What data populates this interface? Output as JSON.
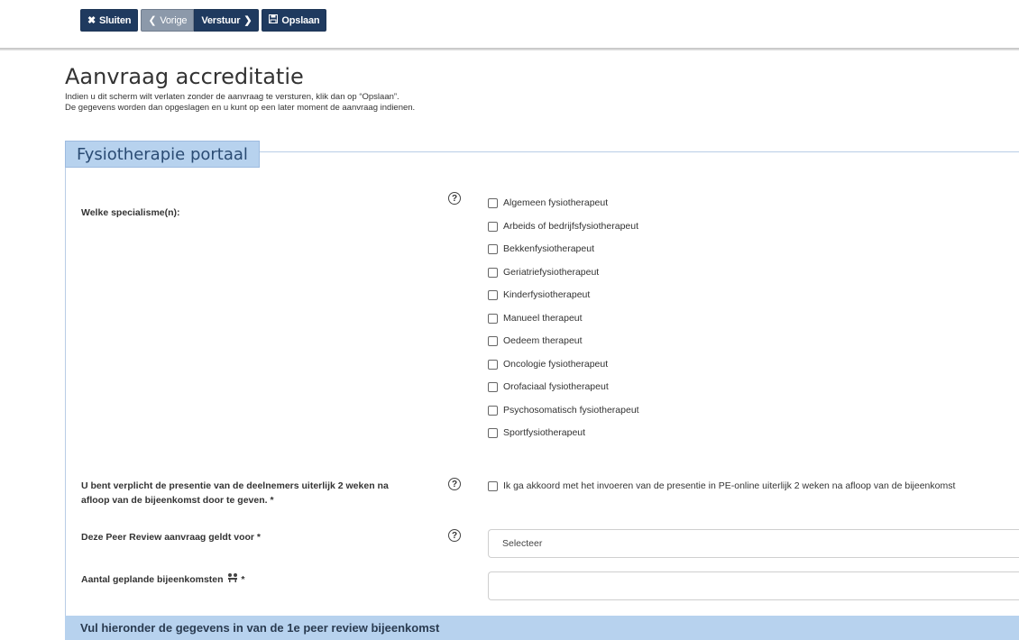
{
  "toolbar": {
    "close_label": "Sluiten",
    "prev_label": "Vorige",
    "send_label": "Verstuur",
    "save_label": "Opslaan"
  },
  "page": {
    "title": "Aanvraag accreditatie",
    "intro_line1": "Indien u dit scherm wilt verlaten zonder de aanvraag te versturen, klik dan op “Opslaan”.",
    "intro_line2": "De gegevens worden dan opgeslagen en u kunt op een later moment de aanvraag indienen."
  },
  "section": {
    "title": "Fysiotherapie portaal"
  },
  "specialisms": {
    "label": "Welke specialisme(n):",
    "options": [
      "Algemeen fysiotherapeut",
      "Arbeids of bedrijfsfysiotherapeut",
      "Bekkenfysiotherapeut",
      "Geriatriefysiotherapeut",
      "Kinderfysiotherapeut",
      "Manueel therapeut",
      "Oedeem therapeut",
      "Oncologie fysiotherapeut",
      "Orofaciaal fysiotherapeut",
      "Psychosomatisch fysiotherapeut",
      "Sportfysiotherapeut"
    ]
  },
  "presence": {
    "label_line1": "U bent verplicht de presentie van de deelnemers uiterlijk 2 weken na",
    "label_line2": "afloop van de bijeenkomst door te geven. *",
    "checkbox_text": "Ik ga akkoord met het invoeren van de presentie in PE-online uiterlijk 2 weken na afloop van de bijeenkomst"
  },
  "peer_review": {
    "label": "Deze Peer Review aanvraag geldt voor *",
    "selected": "Selecteer"
  },
  "meetings": {
    "label": "Aantal geplande bijeenkomsten",
    "required": "*",
    "value": ""
  },
  "footer": {
    "title": "Vul hieronder de gegevens in van de 1e peer review bijeenkomst"
  },
  "help_symbol": "?",
  "colors": {
    "toolbar_dark": "#1f3a5f",
    "toolbar_grey": "#8c99aa",
    "section_blue": "#b7d2ee"
  }
}
